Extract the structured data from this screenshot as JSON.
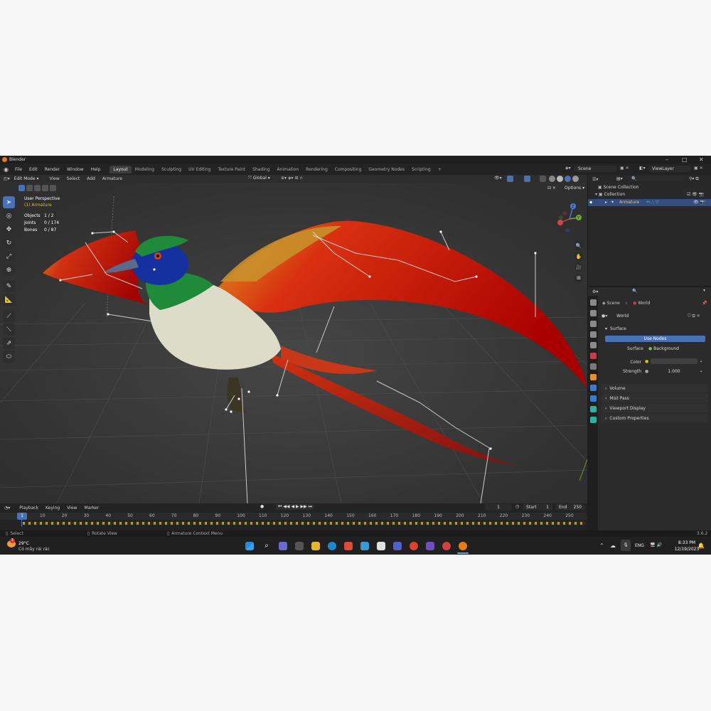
{
  "app": {
    "title": "Blender",
    "version": "3.6.2"
  },
  "menubar": {
    "menus": [
      "File",
      "Edit",
      "Render",
      "Window",
      "Help"
    ],
    "workspaces": [
      "Layout",
      "Modeling",
      "Sculpting",
      "UV Editing",
      "Texture Paint",
      "Shading",
      "Animation",
      "Rendering",
      "Compositing",
      "Geometry Nodes",
      "Scripting"
    ],
    "active_workspace": "Layout",
    "add_workspace": "+",
    "scene": "Scene",
    "view_layer": "ViewLayer"
  },
  "viewport": {
    "mode": "Edit Mode",
    "menus": [
      "View",
      "Select",
      "Add",
      "Armature"
    ],
    "orientation": "Global",
    "options": "Options",
    "overlay_title": "User Perspective",
    "overlay_object": "(1) Armature",
    "stats": [
      {
        "label": "Objects",
        "value": "1 / 2"
      },
      {
        "label": "Joints",
        "value": "0 / 174"
      },
      {
        "label": "Bones",
        "value": "0 / 87"
      }
    ],
    "gizmo": {
      "z": "Z",
      "y": "Y"
    }
  },
  "timeline": {
    "menus": [
      "Playback",
      "Keying",
      "View",
      "Marker"
    ],
    "current_frame": "1",
    "start_label": "Start",
    "start": "1",
    "end_label": "End",
    "end": "250",
    "ruler": [
      "1",
      "10",
      "20",
      "30",
      "40",
      "50",
      "60",
      "70",
      "80",
      "90",
      "100",
      "110",
      "120",
      "130",
      "140",
      "150",
      "160",
      "170",
      "180",
      "190",
      "200",
      "210",
      "220",
      "230",
      "240",
      "250"
    ]
  },
  "statusbar": {
    "select": "Select",
    "rotate": "Rotate View",
    "context": "Armature Context Menu"
  },
  "outliner": {
    "scene_collection": "Scene Collection",
    "collection": "Collection",
    "armature": "Armature"
  },
  "properties": {
    "breadcrumb_scene": "Scene",
    "breadcrumb_world": "World",
    "world_name": "World",
    "surface_panel": "Surface",
    "use_nodes": "Use Nodes",
    "surface_label": "Surface",
    "surface_value": "Background",
    "color_label": "Color",
    "strength_label": "Strength",
    "strength_value": "1.000",
    "panels": [
      "Volume",
      "Mist Pass",
      "Viewport Display",
      "Custom Properties"
    ]
  },
  "taskbar": {
    "weather_temp": "29°C",
    "weather_desc": "Có mây rải rác",
    "weather_badge": "1",
    "lang": "ENG",
    "time": "8:33 PM",
    "date": "12/19/2023"
  },
  "colors": {
    "accent": "#4772b3",
    "blender_orange": "#e87d0d",
    "viewport_bg": "#3a3a3a"
  }
}
